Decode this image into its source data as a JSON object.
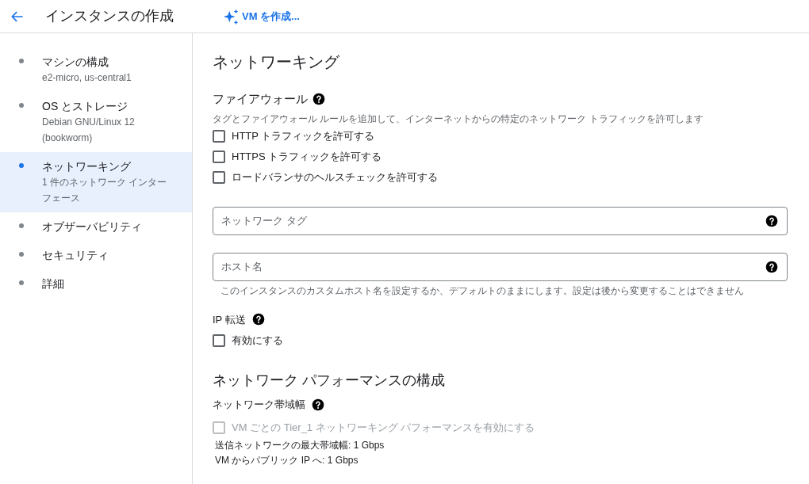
{
  "header": {
    "title": "インスタンスの作成",
    "ai_button": "VM を作成..."
  },
  "sidebar": {
    "items": [
      {
        "title": "マシンの構成",
        "subtitle": "e2-micro, us-central1",
        "selected": false
      },
      {
        "title": "OS とストレージ",
        "subtitle": "Debian GNU/Linux 12 (bookworm)",
        "selected": false
      },
      {
        "title": "ネットワーキング",
        "subtitle": "1 件のネットワーク インターフェース",
        "selected": true
      },
      {
        "title": "オブザーバビリティ",
        "selected": false
      },
      {
        "title": "セキュリティ",
        "selected": false
      },
      {
        "title": "詳細",
        "selected": false
      }
    ]
  },
  "main": {
    "heading": "ネットワーキング",
    "firewall": {
      "label": "ファイアウォール",
      "description": "タグとファイアウォール ルールを追加して、インターネットからの特定のネットワーク トラフィックを許可します",
      "options": [
        {
          "label": "HTTP トラフィックを許可する",
          "checked": false,
          "disabled": false
        },
        {
          "label": "HTTPS トラフィックを許可する",
          "checked": false,
          "disabled": false
        },
        {
          "label": "ロードバランサのヘルスチェックを許可する",
          "checked": false,
          "disabled": false
        }
      ]
    },
    "network_tags": {
      "placeholder": "ネットワーク タグ"
    },
    "hostname": {
      "placeholder": "ホスト名",
      "helper": "このインスタンスのカスタムホスト名を設定するか、デフォルトのままにします。設定は後から変更することはできません"
    },
    "ip_forwarding": {
      "label": "IP 転送",
      "option": {
        "label": "有効にする",
        "checked": false,
        "disabled": false
      }
    },
    "performance": {
      "heading": "ネットワーク パフォーマンスの構成",
      "bandwidth_label": "ネットワーク帯域幅",
      "option": {
        "label": "VM ごとの Tier_1 ネットワーキング パフォーマンスを有効にする",
        "checked": false,
        "disabled": true
      },
      "info": [
        "送信ネットワークの最大帯域幅: 1 Gbps",
        "VM からパブリック IP へ: 1 Gbps"
      ]
    }
  }
}
